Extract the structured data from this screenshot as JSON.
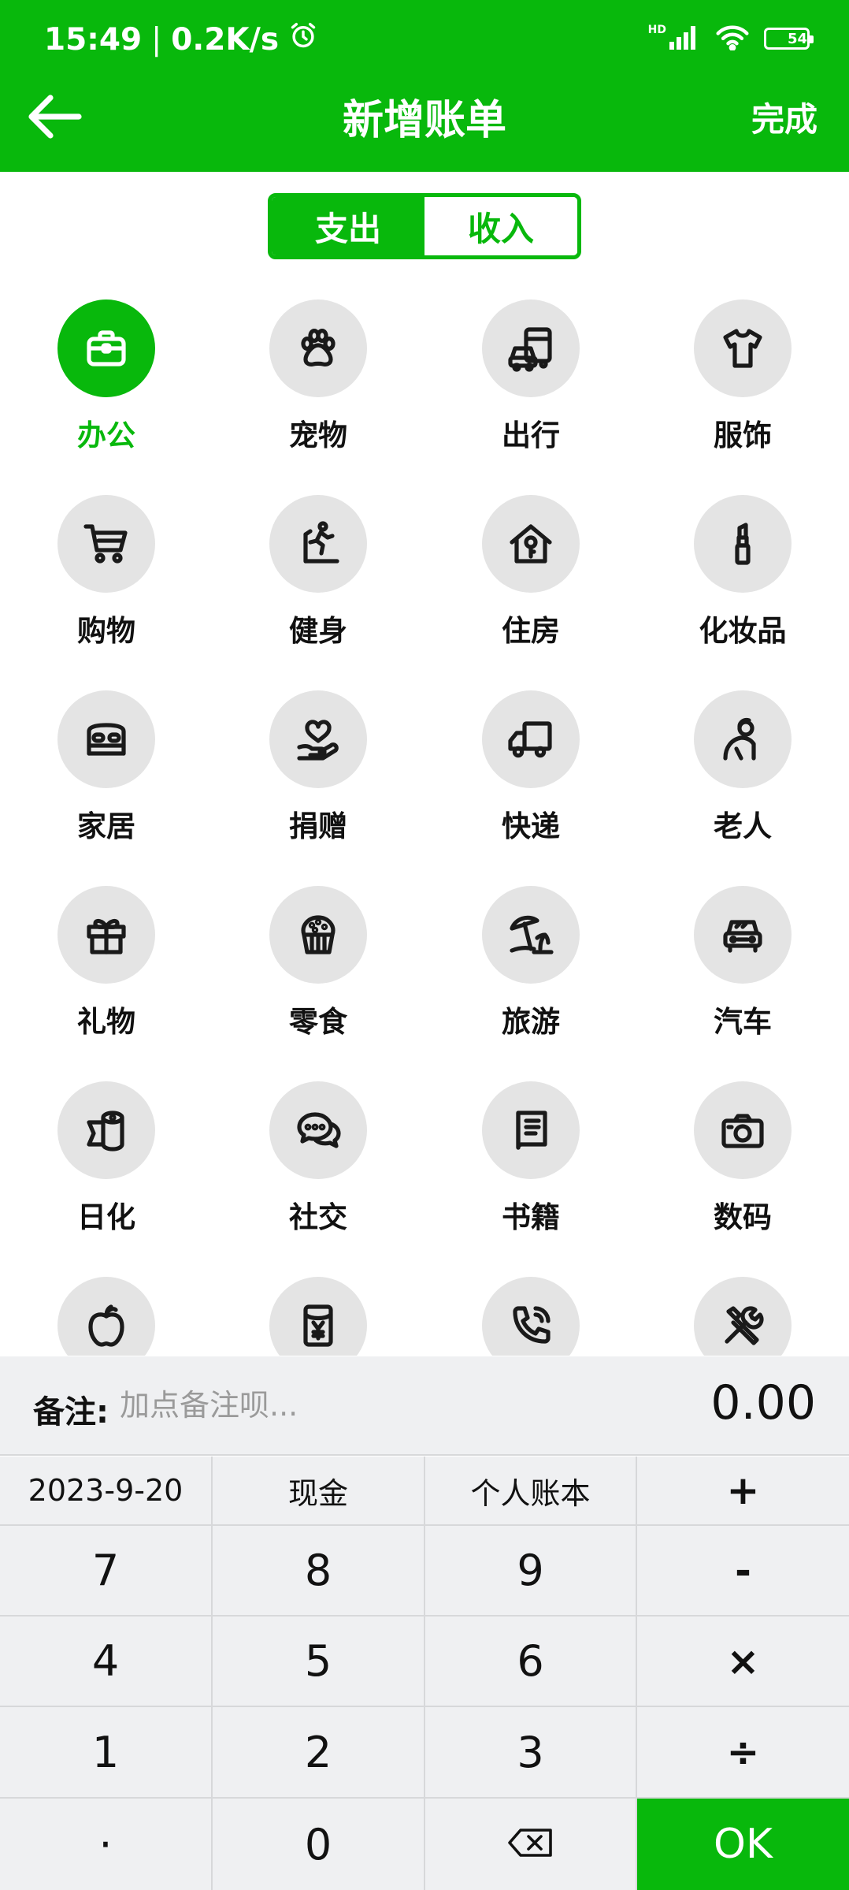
{
  "status_bar": {
    "time": "15:49",
    "network_speed": "0.2K/s",
    "network_type": "HD",
    "battery": "54",
    "icons": [
      "alarm-icon",
      "signal-icon",
      "wifi-icon",
      "battery-icon"
    ]
  },
  "header": {
    "title": "新增账单",
    "done_label": "完成",
    "back_icon": "back-arrow-icon"
  },
  "segment": {
    "expense_label": "支出",
    "income_label": "收入",
    "active": "expense"
  },
  "categories": [
    {
      "label": "办公",
      "icon": "briefcase-icon",
      "selected": true
    },
    {
      "label": "宠物",
      "icon": "paw-icon"
    },
    {
      "label": "出行",
      "icon": "bus-car-icon"
    },
    {
      "label": "服饰",
      "icon": "tshirt-icon"
    },
    {
      "label": "购物",
      "icon": "cart-icon"
    },
    {
      "label": "健身",
      "icon": "treadmill-icon"
    },
    {
      "label": "住房",
      "icon": "house-key-icon"
    },
    {
      "label": "化妆品",
      "icon": "lipstick-icon"
    },
    {
      "label": "家居",
      "icon": "bed-icon"
    },
    {
      "label": "捐赠",
      "icon": "heart-hand-icon"
    },
    {
      "label": "快递",
      "icon": "truck-icon"
    },
    {
      "label": "老人",
      "icon": "elder-icon"
    },
    {
      "label": "礼物",
      "icon": "gift-icon"
    },
    {
      "label": "零食",
      "icon": "cupcake-icon"
    },
    {
      "label": "旅游",
      "icon": "beach-umbrella-icon"
    },
    {
      "label": "汽车",
      "icon": "car-icon"
    },
    {
      "label": "日化",
      "icon": "tissue-roll-icon"
    },
    {
      "label": "社交",
      "icon": "chat-bubbles-icon"
    },
    {
      "label": "书籍",
      "icon": "book-icon"
    },
    {
      "label": "数码",
      "icon": "camera-icon"
    },
    {
      "label": "",
      "icon": "apple-icon"
    },
    {
      "label": "",
      "icon": "red-envelope-icon"
    },
    {
      "label": "",
      "icon": "phone-icon"
    },
    {
      "label": "",
      "icon": "tools-icon"
    }
  ],
  "remark": {
    "label": "备注:",
    "placeholder": "加点备注呗...",
    "value": "",
    "amount": "0.00"
  },
  "keypad": {
    "date": "2023-9-20",
    "account": "现金",
    "book": "个人账本",
    "plus": "+",
    "minus": "-",
    "multiply": "×",
    "divide": "÷",
    "dot": "·",
    "ok": "OK",
    "backspace_icon": "backspace-icon",
    "digits": [
      "7",
      "8",
      "9",
      "4",
      "5",
      "6",
      "1",
      "2",
      "3",
      "0"
    ]
  },
  "colors": {
    "brand": "#08b80c",
    "icon_bg": "#e4e4e4",
    "keypad_bg": "#eff0f2"
  }
}
